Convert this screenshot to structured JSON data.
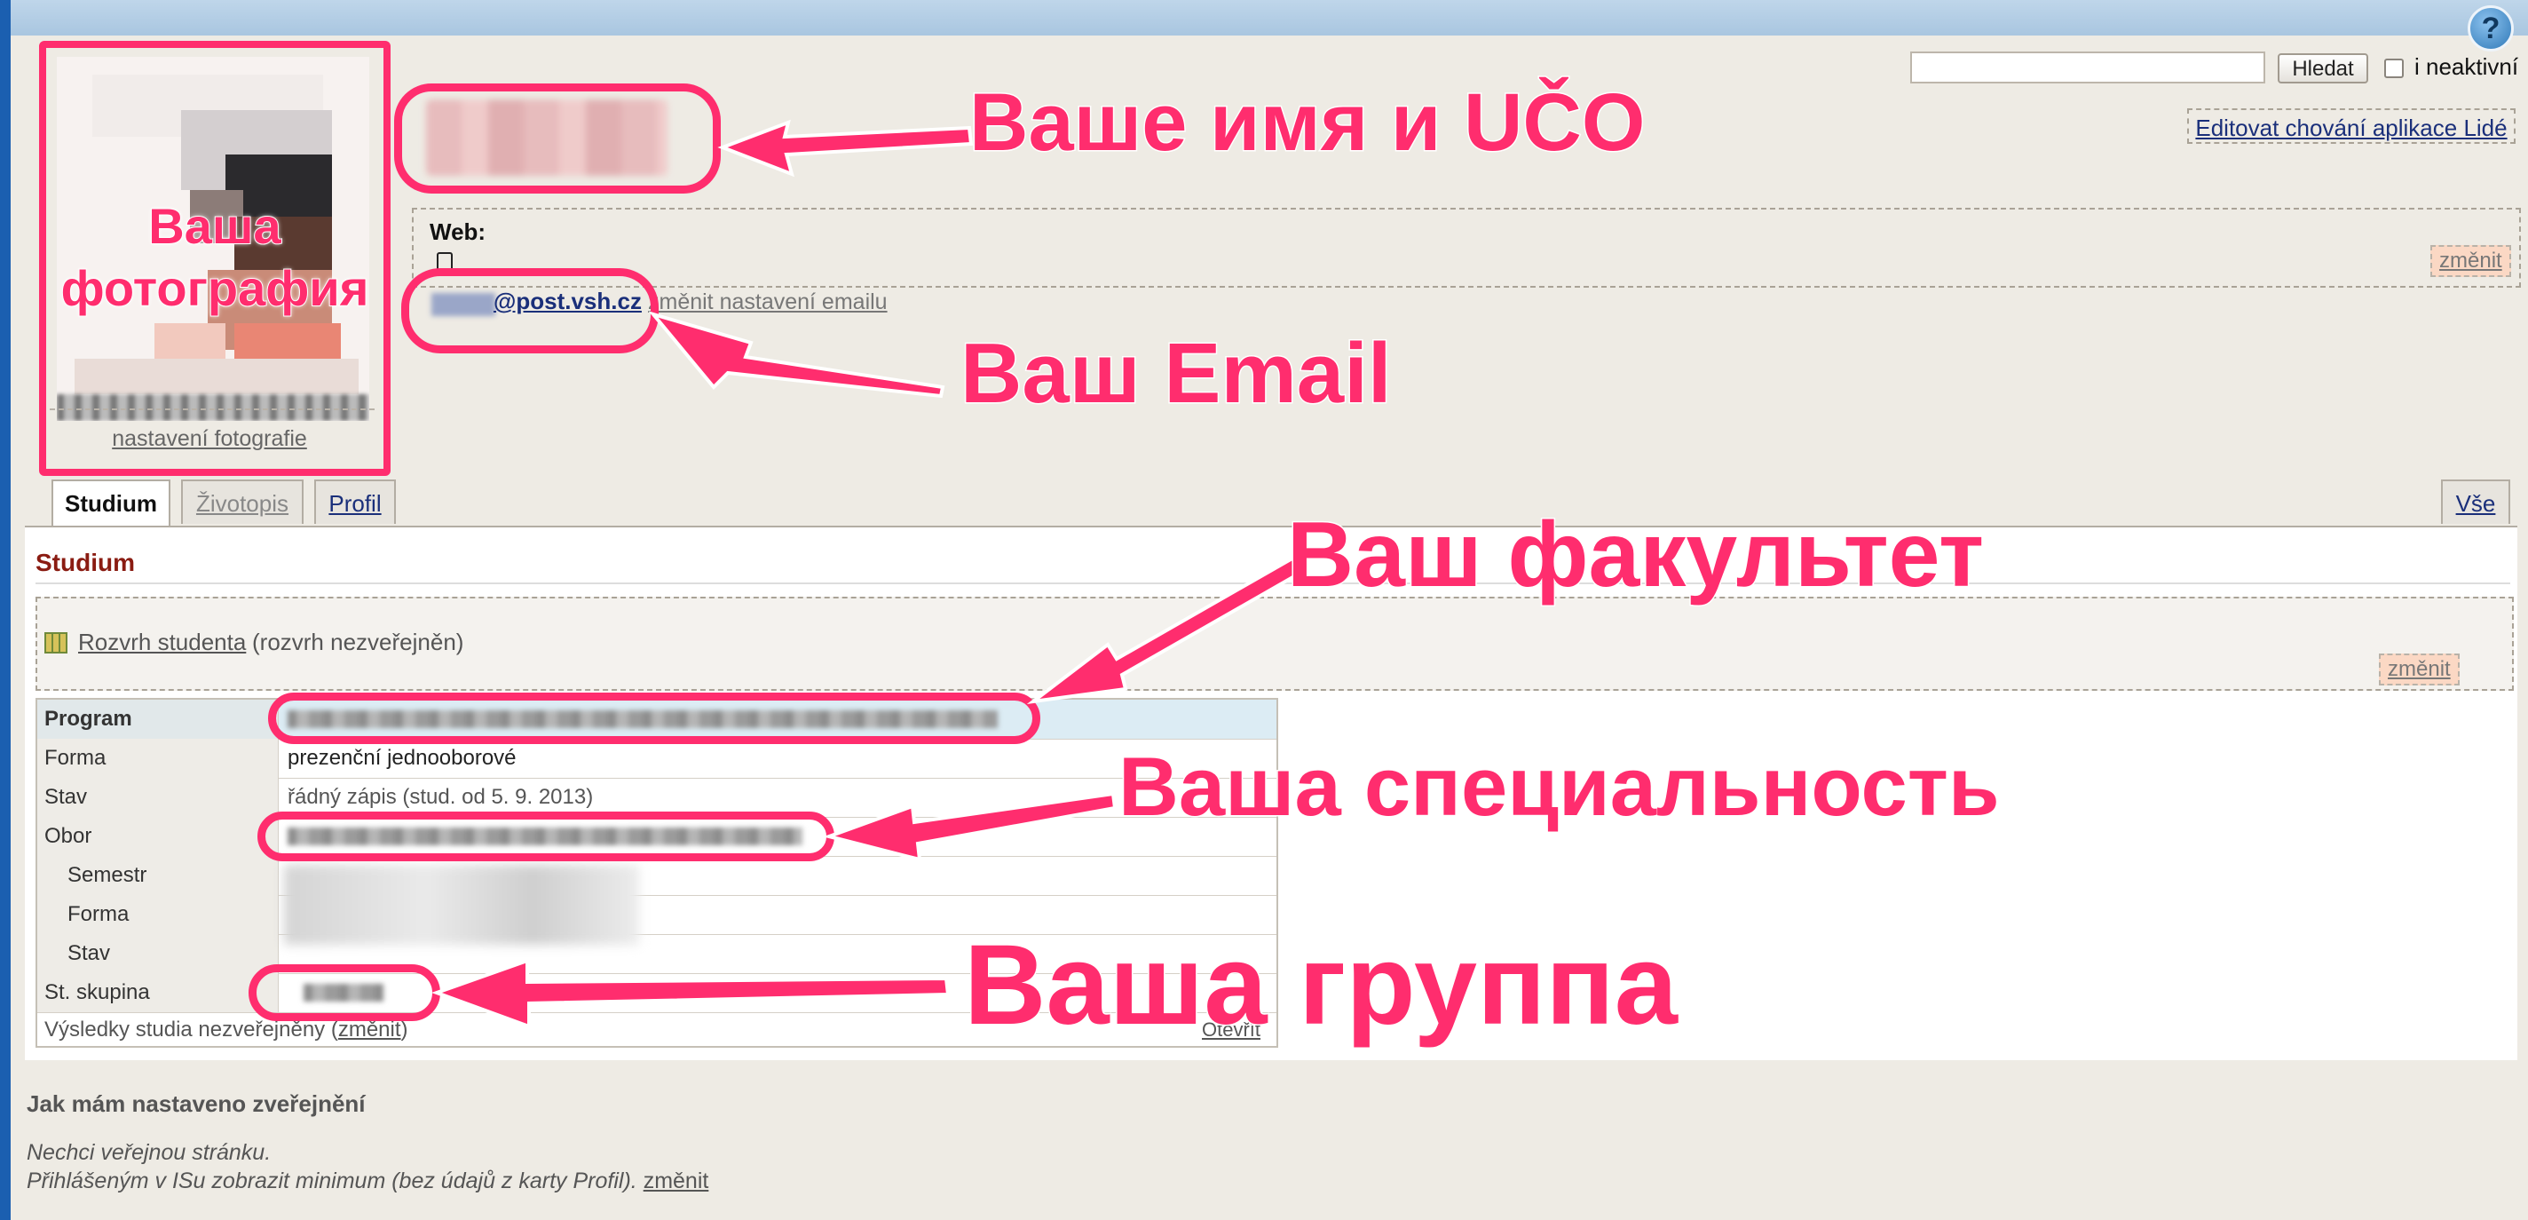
{
  "help_icon": "?",
  "photo": {
    "label_line1": "Ваша",
    "label_line2": "фотография",
    "settings_link": "nastavení fotografie"
  },
  "annotations": {
    "name": "Ваше имя и UČO",
    "email": "Ваш Email",
    "faculty": "Ваш факультет",
    "specialty": "Ваша специальность",
    "group": "Ваша группа"
  },
  "search": {
    "placeholder": "",
    "button": "Hledat",
    "inactive_label": "i neaktivní"
  },
  "edit_link": "Editovat chování aplikace Lidé",
  "web": {
    "label": "Web:",
    "change": "změnit"
  },
  "email": {
    "domain": "@post.vsh.cz",
    "change_link": "změnit nastavení emailu"
  },
  "tabs": [
    {
      "label": "Studium",
      "active": true
    },
    {
      "label": "Životopis"
    },
    {
      "label": "Profil"
    }
  ],
  "tab_all": "Vše",
  "panel": {
    "title": "Studium",
    "rozvrh_link": "Rozvrh studenta",
    "rozvrh_note": "(rozvrh nezveřejněn)",
    "change": "změnit"
  },
  "table": {
    "rows": [
      {
        "key": "Program",
        "value": ""
      },
      {
        "key": "Forma",
        "value": "prezenční jednooborové"
      },
      {
        "key": "Stav",
        "value": "řádný zápis (stud. od 5. 9. 2013)"
      },
      {
        "key": "Obor",
        "value": ""
      },
      {
        "key": "Semestr",
        "value": ""
      },
      {
        "key": "Forma",
        "value": ""
      },
      {
        "key": "Stav",
        "value": ""
      },
      {
        "key": "St. skupina",
        "value": ""
      }
    ],
    "results_text": "Výsledky studia nezveřejněny (",
    "results_link": "změnit",
    "results_close": ")",
    "right_link": "Otevřít"
  },
  "footer": {
    "title": "Jak mám nastaveno zveřejnění",
    "line1": "Nechci veřejnou stránku.",
    "line2": "Přihlášeným v ISu zobrazit minimum (bez údajů z karty Profil).",
    "link": "změnit"
  },
  "colors": {
    "annotation": "#ff2d6e",
    "link": "#1a2f7a",
    "heading": "#8a1c12"
  }
}
